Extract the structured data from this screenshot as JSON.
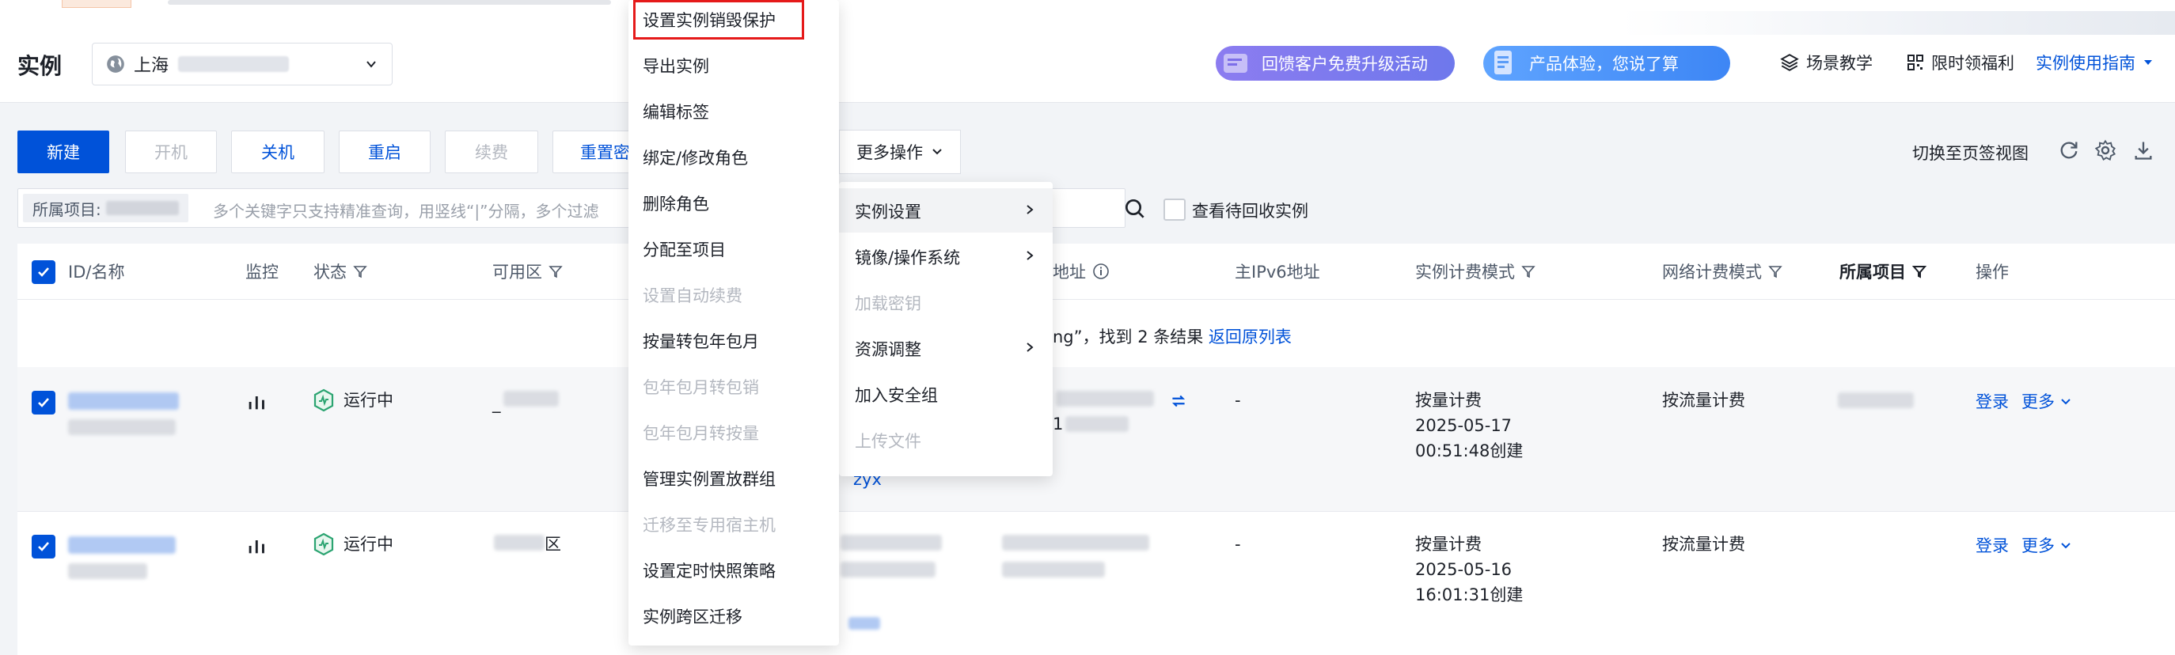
{
  "header": {
    "title": "实例",
    "region": "上海",
    "promo1": "回馈客户免费升级活动",
    "promo2": "产品体验，您说了算",
    "link_tutorial": "场景教学",
    "link_benefits": "限时领福利",
    "link_guide": "实例使用指南"
  },
  "toolbar": {
    "new": "新建",
    "start": "开机",
    "shutdown": "关机",
    "restart": "重启",
    "renew": "续费",
    "reset_pwd": "重置密",
    "more_ops": "更多操作",
    "switch_view": "切换至页签视图"
  },
  "search": {
    "project_label": "所属项目:",
    "placeholder": "多个关键字只支持精准查询，用竖线“|”分隔，多个过滤",
    "recycle_label": "查看待回收实例"
  },
  "table": {
    "headers": {
      "id_name": "ID/名称",
      "monitor": "监控",
      "status": "状态",
      "zone": "可用区",
      "ip": "地址",
      "ipv6": "主IPv6地址",
      "billing": "实例计费模式",
      "net_billing": "网络计费模式",
      "project": "所属项目",
      "actions": "操作"
    },
    "result_text": "ng”，找到 2 条结果",
    "back_link": "返回原列表",
    "rows": [
      {
        "status": "运行中",
        "zone_prefix": "_",
        "ipv6": "-",
        "billing_mode": "按量计费",
        "billing_date": "2025-05-17",
        "billing_time": "00:51:48创建",
        "net_billing": "按流量计费",
        "ip_suffix": "1",
        "extra_link": "zyx",
        "login": "登录",
        "more": "更多"
      },
      {
        "status": "运行中",
        "zone_suffix": "区",
        "ipv6": "-",
        "billing_mode": "按量计费",
        "billing_date": "2025-05-16",
        "billing_time": "16:01:31创建",
        "net_billing": "按流量计费",
        "login": "登录",
        "more": "更多"
      }
    ]
  },
  "menu_main": [
    {
      "label": "设置实例销毁保护",
      "disabled": false
    },
    {
      "label": "导出实例",
      "disabled": false
    },
    {
      "label": "编辑标签",
      "disabled": false
    },
    {
      "label": "绑定/修改角色",
      "disabled": false
    },
    {
      "label": "删除角色",
      "disabled": false
    },
    {
      "label": "分配至项目",
      "disabled": false
    },
    {
      "label": "设置自动续费",
      "disabled": true
    },
    {
      "label": "按量转包年包月",
      "disabled": false
    },
    {
      "label": "包年包月转包销",
      "disabled": true
    },
    {
      "label": "包年包月转按量",
      "disabled": true
    },
    {
      "label": "管理实例置放群组",
      "disabled": false
    },
    {
      "label": "迁移至专用宿主机",
      "disabled": true
    },
    {
      "label": "设置定时快照策略",
      "disabled": false
    },
    {
      "label": "实例跨区迁移",
      "disabled": false
    }
  ],
  "menu_more": [
    {
      "label": "实例设置",
      "disabled": false,
      "submenu": true
    },
    {
      "label": "镜像/操作系统",
      "disabled": false,
      "submenu": true
    },
    {
      "label": "加载密钥",
      "disabled": true,
      "submenu": false
    },
    {
      "label": "资源调整",
      "disabled": false,
      "submenu": true
    },
    {
      "label": "加入安全组",
      "disabled": false,
      "submenu": false
    },
    {
      "label": "上传文件",
      "disabled": true,
      "submenu": false
    }
  ],
  "colors": {
    "primary": "#0052d9",
    "running": "#2ba471",
    "highlight_border": "#e51a1a"
  }
}
